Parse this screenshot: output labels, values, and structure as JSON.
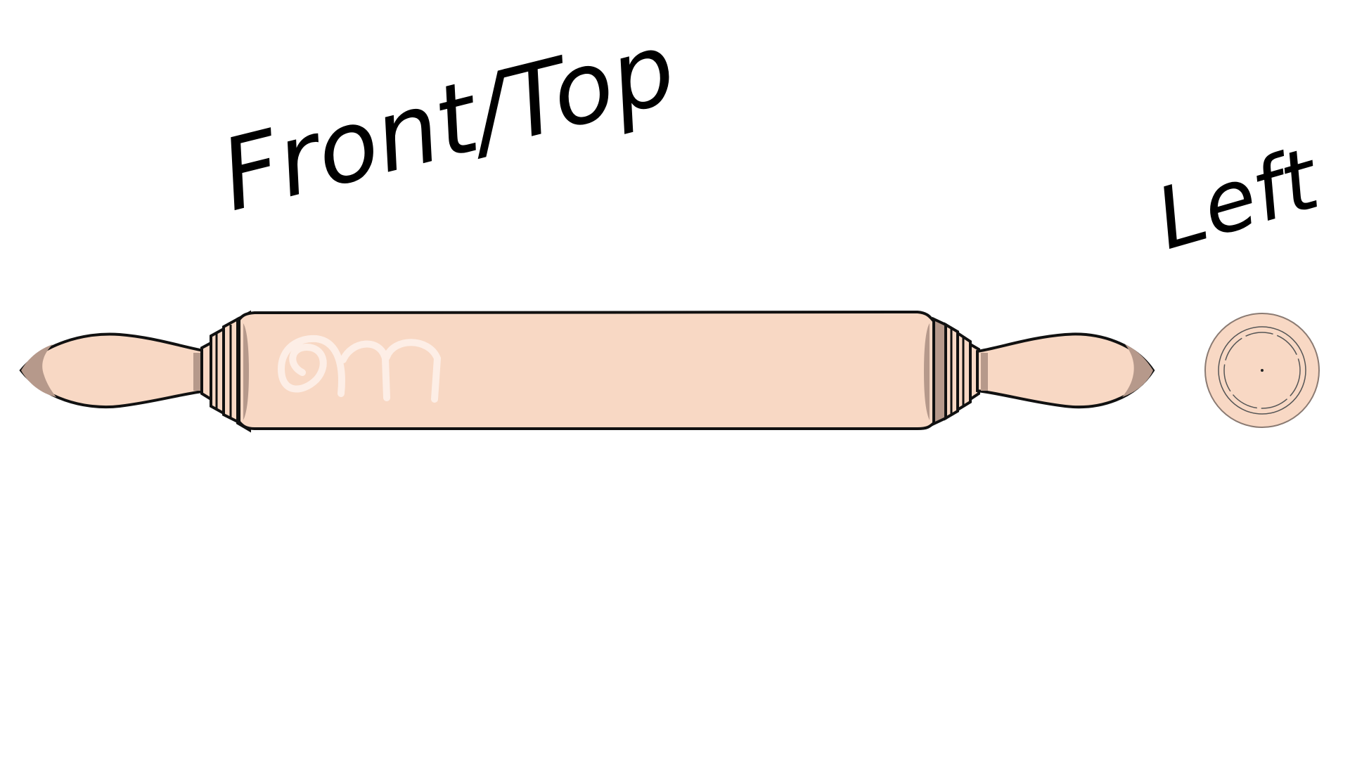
{
  "labels": {
    "front_top": "Front/Top",
    "left": "Left"
  },
  "colors": {
    "wood": "#f8d8c4",
    "wood_shadow": "#b6998b",
    "outline": "#111111",
    "background": "#ffffff",
    "swirl": "#fdeee6"
  },
  "icons": {
    "front_view": "rolling-pin-front-icon",
    "side_view": "rolling-pin-end-icon"
  }
}
